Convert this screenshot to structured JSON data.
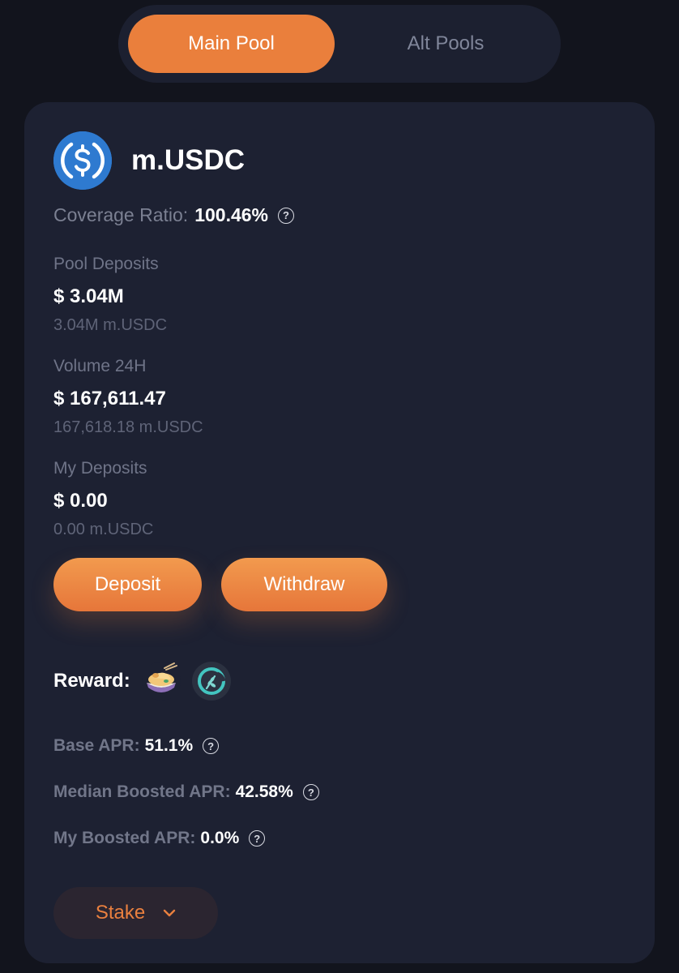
{
  "tabs": [
    {
      "label": "Main Pool",
      "active": true
    },
    {
      "label": "Alt Pools",
      "active": false
    }
  ],
  "token": {
    "name": "m.USDC",
    "icon": "usdc-coin-icon",
    "icon_color": "#2e7ad0"
  },
  "coverage": {
    "label": "Coverage Ratio:",
    "value": "100.46%"
  },
  "pool_deposits": {
    "label": "Pool Deposits",
    "value": "$ 3.04M",
    "sub": "3.04M m.USDC"
  },
  "volume": {
    "label": "Volume 24H",
    "value": "$ 167,611.47",
    "sub": "167,618.18 m.USDC"
  },
  "my_deposits": {
    "label": "My Deposits",
    "value": "$ 0.00",
    "sub": "0.00 m.USDC"
  },
  "actions": {
    "deposit": "Deposit",
    "withdraw": "Withdraw"
  },
  "reward": {
    "label": "Reward:",
    "icons": [
      "noodle-bowl-token-icon",
      "wheat-token-icon"
    ]
  },
  "apr": {
    "base_label": "Base APR:",
    "base_value": "51.1%",
    "median_label": "Median Boosted APR:",
    "median_value": "42.58%",
    "my_label": "My Boosted APR:",
    "my_value": "0.0%"
  },
  "stake": {
    "label": "Stake"
  },
  "colors": {
    "accent": "#ea7f3c",
    "background": "#12141d",
    "card": "#1d2132"
  }
}
